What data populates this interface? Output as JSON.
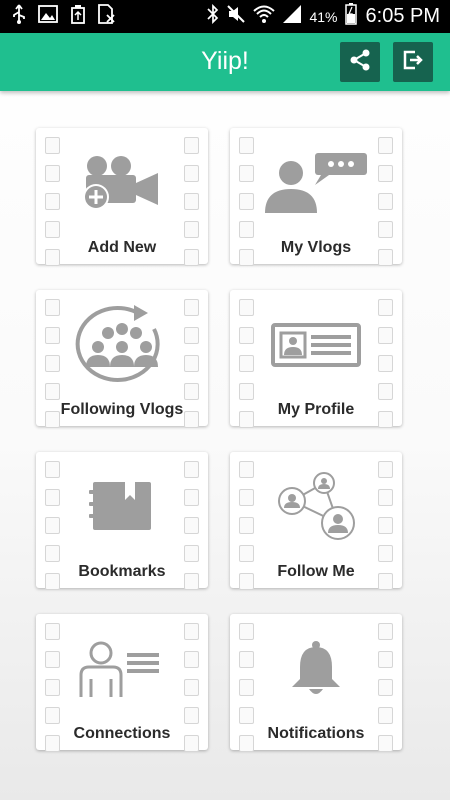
{
  "status_bar": {
    "battery_percent": "41%",
    "time": "6:05 PM",
    "left_icons": [
      "usb-icon",
      "image-icon",
      "recycle-icon",
      "sim-icon"
    ],
    "right_icons": [
      "bluetooth-icon",
      "mute-icon",
      "wifi-icon",
      "signal-icon",
      "battery-icon"
    ]
  },
  "app_bar": {
    "title": "Yiip!",
    "background": "#1fbf8f",
    "button_background": "#16634f",
    "actions": [
      "share-icon",
      "logout-icon"
    ]
  },
  "tiles": [
    {
      "label": "Add New",
      "icon": "add-video-icon"
    },
    {
      "label": "My Vlogs",
      "icon": "speaker-chat-icon"
    },
    {
      "label": "Following Vlogs",
      "icon": "group-refresh-icon"
    },
    {
      "label": "My Profile",
      "icon": "id-card-icon"
    },
    {
      "label": "Bookmarks",
      "icon": "bookmark-book-icon"
    },
    {
      "label": "Follow Me",
      "icon": "network-users-icon"
    },
    {
      "label": "Connections",
      "icon": "contact-list-icon"
    },
    {
      "label": "Notifications",
      "icon": "bell-icon"
    }
  ]
}
